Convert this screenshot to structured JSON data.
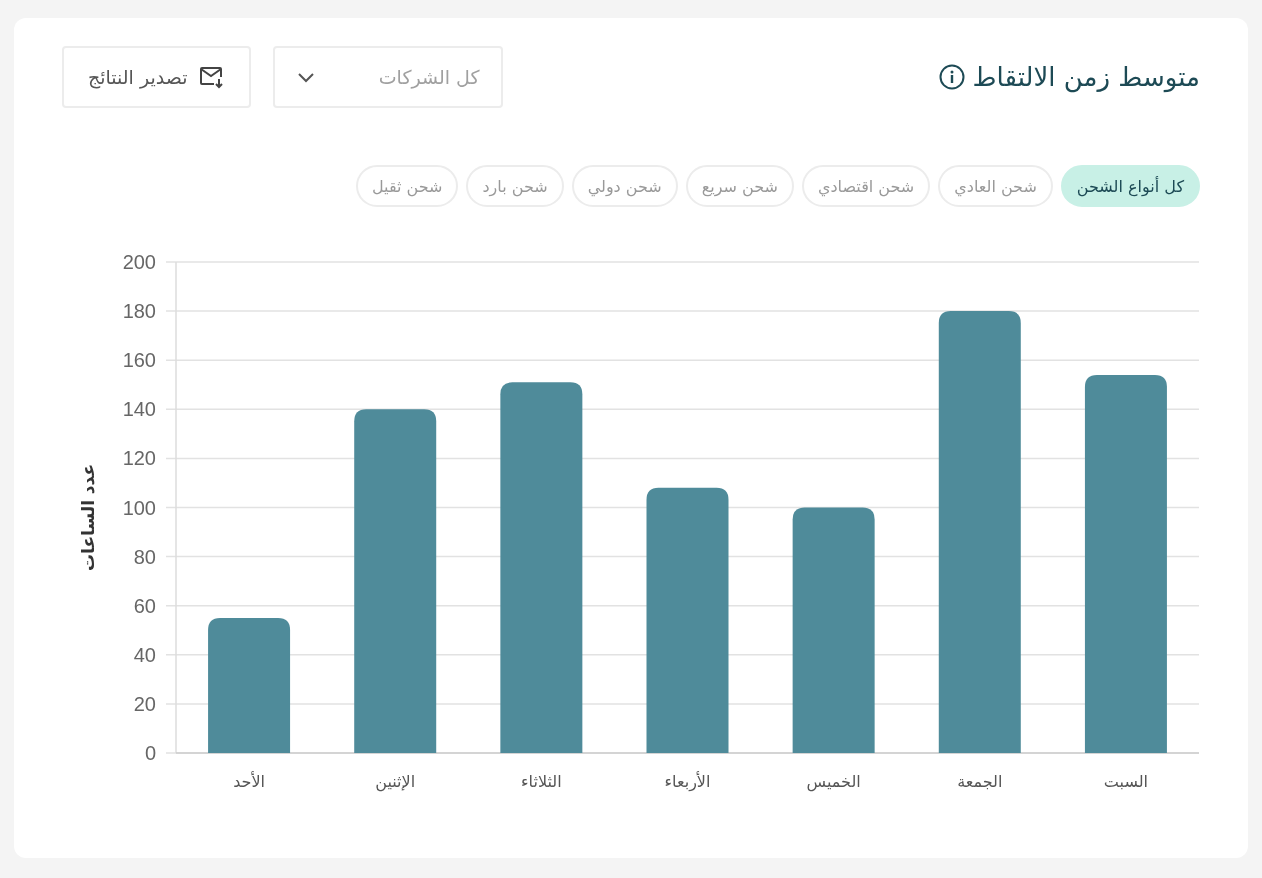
{
  "header": {
    "title": "متوسط زمن الالتقاط",
    "company_filter": {
      "value": "كل الشركات"
    },
    "export_button": "تصدير النتائج"
  },
  "shipping_types": [
    {
      "label": "كل أنواع الشحن",
      "selected": true
    },
    {
      "label": "شحن العادي",
      "selected": false
    },
    {
      "label": "شحن اقتصادي",
      "selected": false
    },
    {
      "label": "شحن سريع",
      "selected": false
    },
    {
      "label": "شحن دولي",
      "selected": false
    },
    {
      "label": "شحن بارد",
      "selected": false
    },
    {
      "label": "شحن ثقيل",
      "selected": false
    }
  ],
  "chart_data": {
    "type": "bar",
    "ylabel": "عدد الساعات",
    "categories": [
      "الأحد",
      "الإثنين",
      "الثلاثاء",
      "الأربعاء",
      "الخميس",
      "الجمعة",
      "السبت"
    ],
    "series": [
      {
        "color": "#4f8b9a",
        "values": [
          55,
          140,
          151,
          108,
          100,
          180,
          154
        ]
      }
    ],
    "grid": true,
    "ylim": [
      0,
      200
    ],
    "yticks": [
      0,
      20,
      40,
      60,
      80,
      100,
      120,
      140,
      160,
      180,
      200
    ]
  }
}
